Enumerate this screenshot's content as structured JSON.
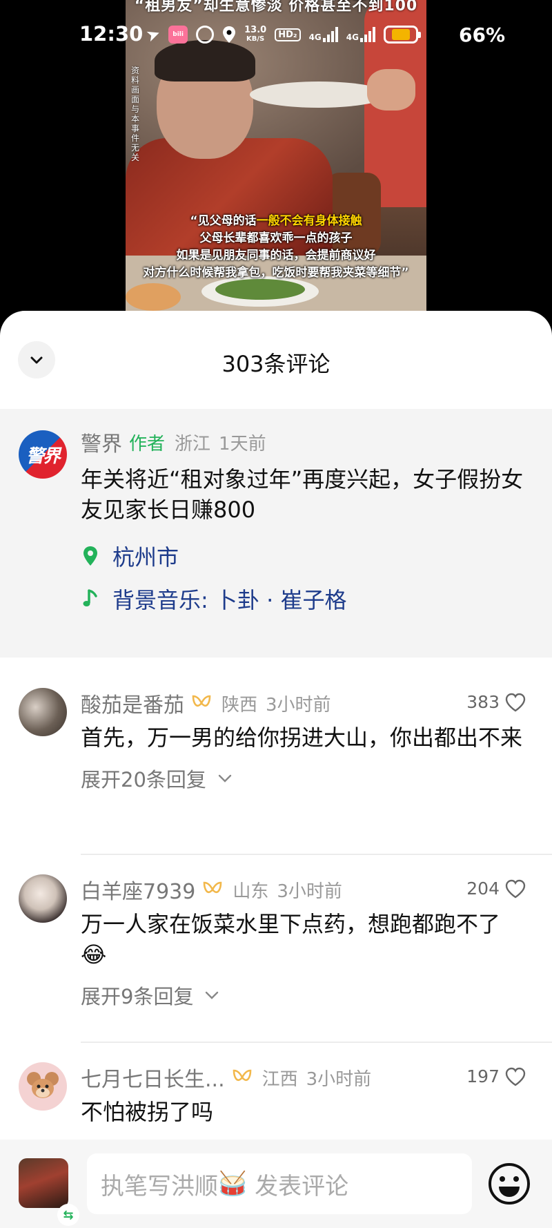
{
  "status_bar": {
    "time": "12:30",
    "net_speed_value": "13.0",
    "net_speed_unit": "KB/S",
    "hd_label": "HD₂",
    "net1": "4G",
    "net2": "4G",
    "battery_pct": "66%",
    "battery_level": 0.66
  },
  "video": {
    "title_overlay": "“租男友”却生意惨淡 价格甚至不到100",
    "side_note": "资料画面与本事件无关",
    "subtitle": {
      "line1_prefix": "“见父母的话",
      "line1_highlight": "一般不会有身体接触",
      "line2": "父母长辈都喜欢乖一点的孩子",
      "line3": "如果是见朋友同事的话，会提前商议好",
      "line4": "对方什么时候帮我拿包，吃饭时要帮我夹菜等细节”"
    }
  },
  "comments_sheet": {
    "title": "303条评论",
    "pinned": {
      "username": "警界",
      "author_tag": "作者",
      "location": "浙江",
      "time": "1天前",
      "avatar_text": "警界",
      "text": "年关将近“租对象过年”再度兴起，女子假扮女友见家长日赚800",
      "place": "杭州市",
      "music": "背景音乐: 卜卦 · 崔子格"
    },
    "comments": [
      {
        "username": "酸茄是番茄",
        "location": "陕西",
        "time": "3小时前",
        "likes": "383",
        "text": "首先，万一男的给你拐进大山，你出都出不来",
        "expand": "展开20条回复"
      },
      {
        "username": "白羊座7939",
        "location": "山东",
        "time": "3小时前",
        "likes": "204",
        "text": "万一人家在饭菜水里下点药，想跑都跑不了",
        "emoji": "😂",
        "expand": "展开9条回复"
      },
      {
        "username": "七月七日长生...",
        "location": "江西",
        "time": "3小时前",
        "likes": "197",
        "text": "不怕被拐了吗"
      }
    ]
  },
  "bottom_bar": {
    "input_placeholder_prefix": "执笔写洪顺",
    "input_placeholder_emoji": "🥁",
    "input_placeholder_suffix": " 发表评论"
  },
  "colors": {
    "author_green": "#23b25a",
    "link_blue": "#1d3b8b",
    "subtitle_highlight": "#ffd400",
    "badge_gold": "#f2b84b"
  }
}
